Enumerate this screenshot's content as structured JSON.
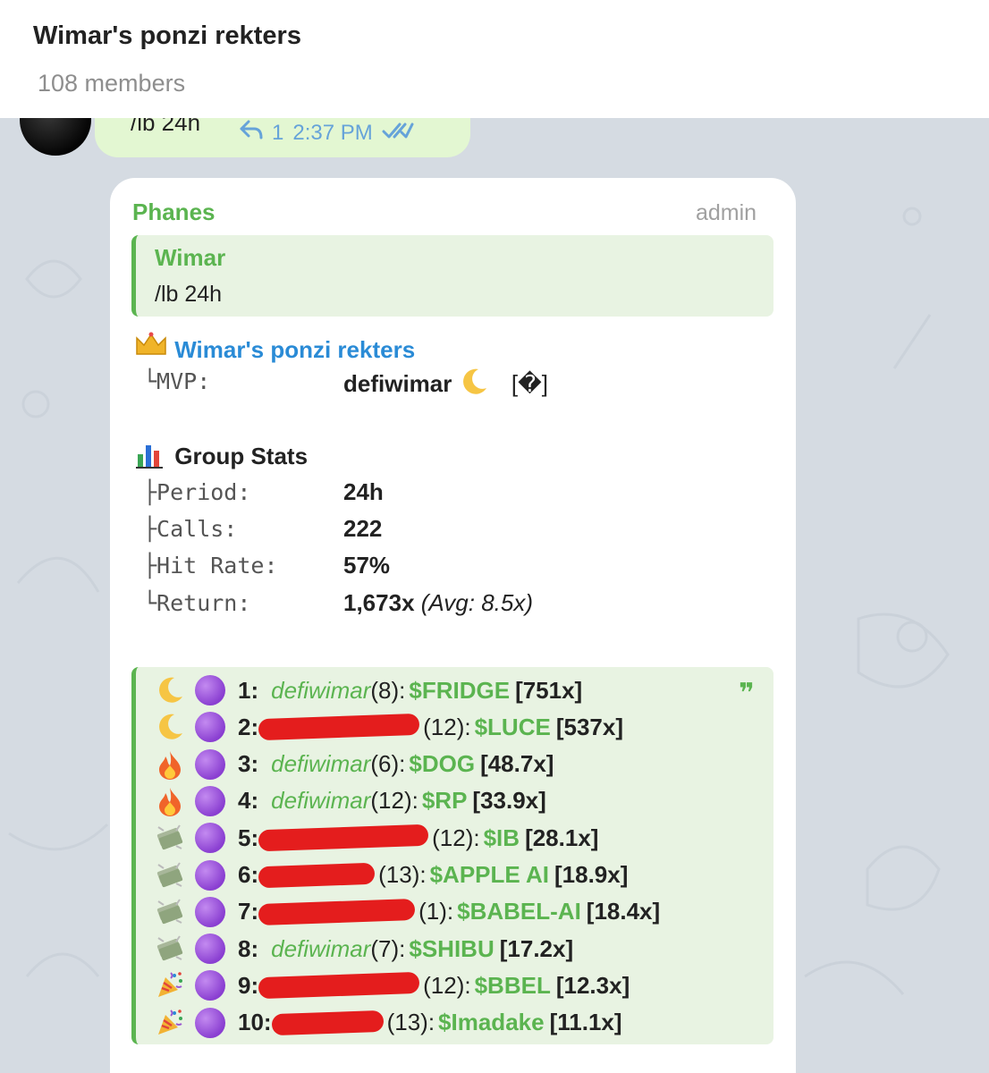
{
  "header": {
    "title": "Wimar's ponzi rekters",
    "subtitle": "108 members"
  },
  "outgoing": {
    "text": "/lb 24h",
    "reply_count": "1",
    "time": "2:37 PM"
  },
  "message": {
    "sender": "Phanes",
    "role": "admin",
    "quote": {
      "name": "Wimar",
      "text": "/lb 24h"
    },
    "group_icon": "crown",
    "group_name": "Wimar's ponzi rekters",
    "mvp_label": "└MVP:",
    "mvp_value": "defiwimar",
    "mvp_extra": "[�]",
    "stats_title": "Group Stats",
    "stats": [
      {
        "label": "├Period:",
        "value": "24h"
      },
      {
        "label": "├Calls:",
        "value": "222"
      },
      {
        "label": "├Hit Rate:",
        "value": "57%"
      },
      {
        "label": "└Return:",
        "value": "1,673x",
        "extra": "(Avg: 8.5x)"
      }
    ]
  },
  "leaderboard": [
    {
      "icon": "moon",
      "rank": "1:",
      "user": "defiwimar",
      "count": "(8):",
      "ticker": "$FRIDGE",
      "mult": "[751x]"
    },
    {
      "icon": "moon",
      "rank": "2:",
      "user": "",
      "count": "(12):",
      "ticker": "$LUCE",
      "mult": "[537x]"
    },
    {
      "icon": "fire",
      "rank": "3:",
      "user": "defiwimar",
      "count": "(6):",
      "ticker": "$DOG",
      "mult": "[48.7x]"
    },
    {
      "icon": "fire",
      "rank": "4:",
      "user": "defiwimar",
      "count": "(12):",
      "ticker": "$RP",
      "mult": "[33.9x]"
    },
    {
      "icon": "money",
      "rank": "5:",
      "user": "",
      "count": "(12):",
      "ticker": "$IB",
      "mult": "[28.1x]"
    },
    {
      "icon": "money",
      "rank": "6:",
      "user": "",
      "count": "(13):",
      "ticker": "$APPLE AI",
      "mult": "[18.9x]"
    },
    {
      "icon": "money",
      "rank": "7:",
      "user": "",
      "count": "(1):",
      "ticker": "$BABEL-AI",
      "mult": "[18.4x]"
    },
    {
      "icon": "money",
      "rank": "8:",
      "user": "defiwimar",
      "count": "(7):",
      "ticker": "$SHIBU",
      "mult": "[17.2x]"
    },
    {
      "icon": "party",
      "rank": "9:",
      "user": "",
      "count": "(12):",
      "ticker": "$BBEL",
      "mult": "[12.3x]"
    },
    {
      "icon": "party",
      "rank": "10:",
      "user": "",
      "count": "(13):",
      "ticker": "$Imadake",
      "mult": "[11.1x]"
    }
  ]
}
